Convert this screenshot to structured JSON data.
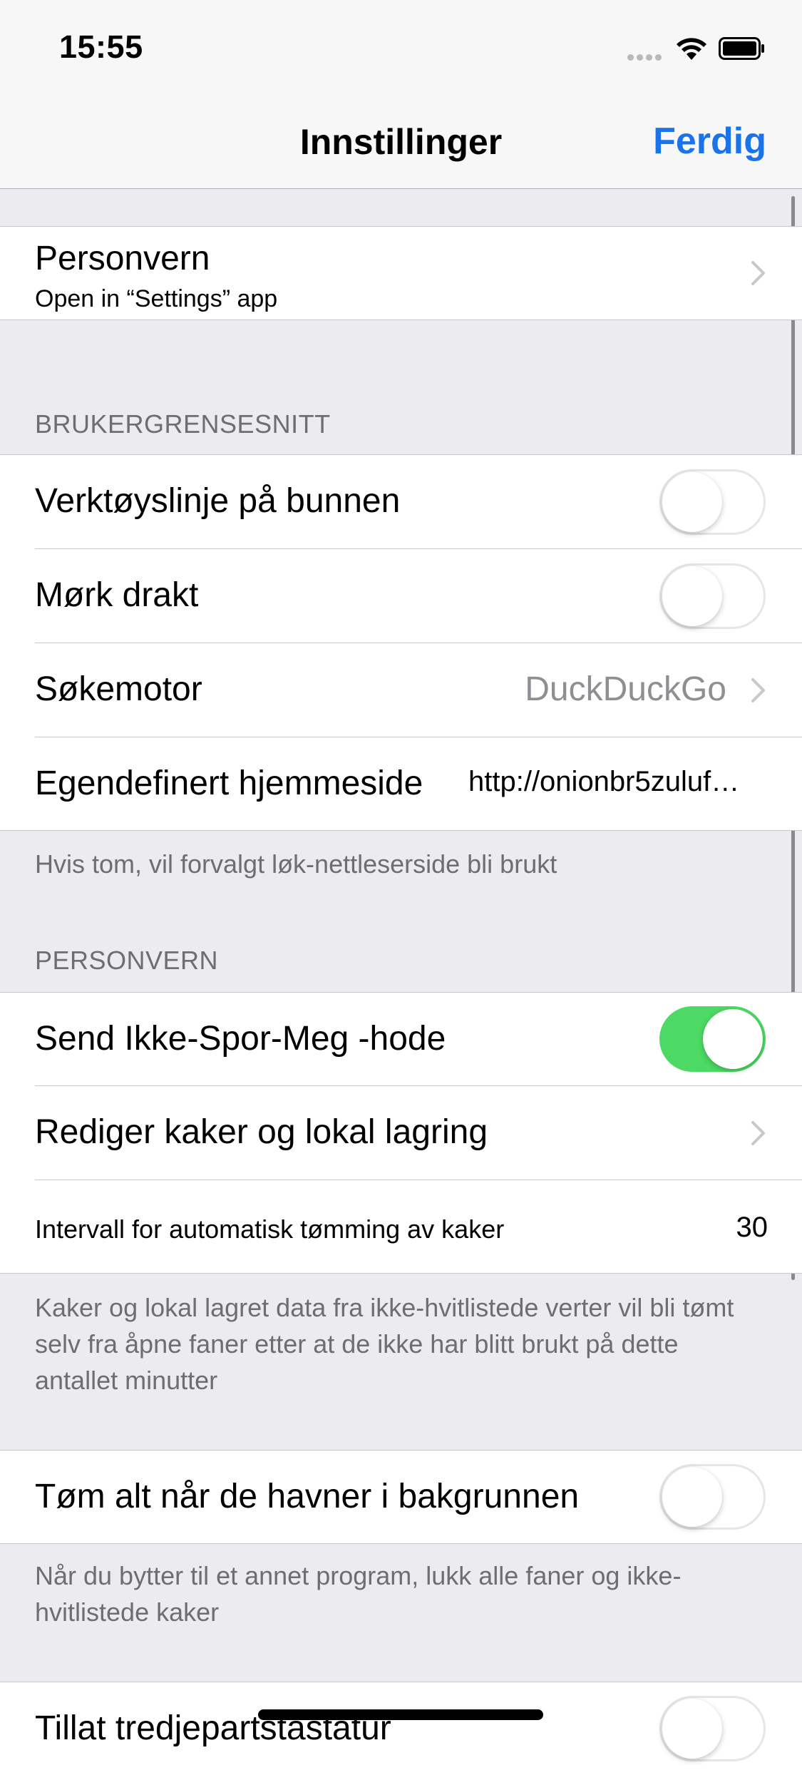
{
  "status": {
    "time": "15:55"
  },
  "nav": {
    "title": "Innstillinger",
    "done": "Ferdig"
  },
  "privacy_link": {
    "title": "Personvern",
    "subtitle": "Open in “Settings” app"
  },
  "ui_section": {
    "header": "BRUKERGRENSESNITT",
    "toolbar_bottom": {
      "label": "Verktøyslinje på bunnen",
      "on": false
    },
    "dark_theme": {
      "label": "Mørk drakt",
      "on": false
    },
    "search_engine": {
      "label": "Søkemotor",
      "value": "DuckDuckGo"
    },
    "custom_homepage": {
      "label": "Egendefinert hjemmeside",
      "value": "http://onionbr5zuluf…"
    },
    "footer": "Hvis tom, vil forvalgt løk-nettleserside bli brukt"
  },
  "privacy_section": {
    "header": "PERSONVERN",
    "dnt": {
      "label": "Send Ikke-Spor-Meg -hode",
      "on": true
    },
    "cookies": {
      "label": "Rediger kaker og lokal lagring"
    },
    "interval": {
      "label": "Intervall for automatisk tømming av kaker",
      "value": "30"
    },
    "footer": "Kaker og lokal lagret data fra ikke-hvitlistede verter vil bli tømt selv fra åpne faner etter at de ikke har blitt brukt på dette antallet minutter"
  },
  "background_section": {
    "clear_all": {
      "label": "Tøm alt når de havner i bakgrunnen",
      "on": false
    },
    "footer": "Når du bytter til et annet program, lukk alle faner og ikke-hvitlistede kaker"
  },
  "third_party_keyboard": {
    "label": "Tillat tredjepartstastatur",
    "on": false
  },
  "colors": {
    "accent": "#1A73E8",
    "toggle_on": "#4CD964",
    "secondary_text": "#6D6D72",
    "grouped_background": "#EBEBF0"
  }
}
